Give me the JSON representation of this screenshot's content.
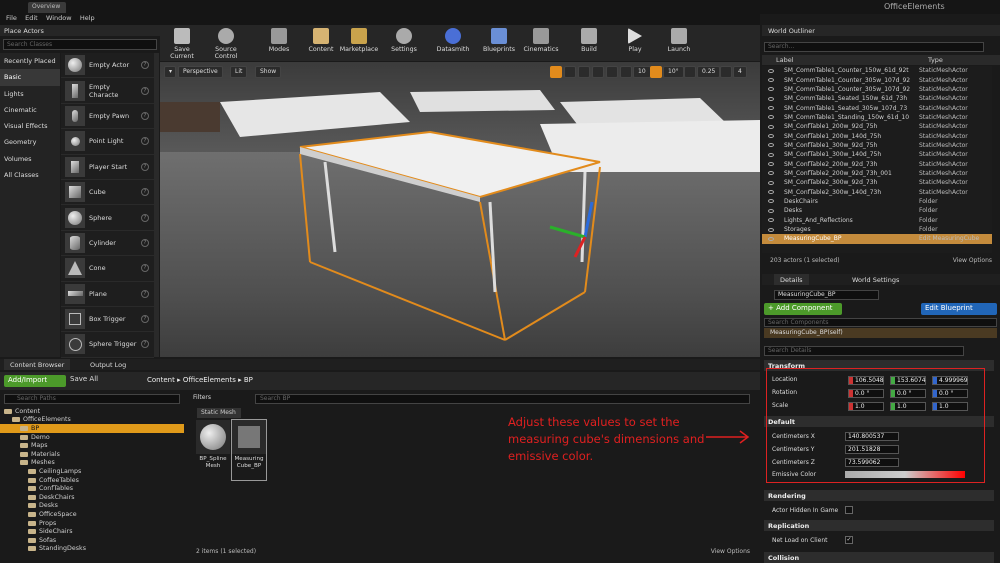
{
  "titlebar": {
    "tab": "Overview",
    "project": "OfficeElements"
  },
  "menu": [
    "File",
    "Edit",
    "Window",
    "Help"
  ],
  "place_actors": {
    "tab": "Place Actors",
    "search_placeholder": "Search Classes",
    "categories": [
      "Recently Placed",
      "Basic",
      "Lights",
      "Cinematic",
      "Visual Effects",
      "Geometry",
      "Volumes",
      "All Classes"
    ],
    "items": [
      "Empty Actor",
      "Empty Characte",
      "Empty Pawn",
      "Point Light",
      "Player Start",
      "Cube",
      "Sphere",
      "Cylinder",
      "Cone",
      "Plane",
      "Box Trigger",
      "Sphere Trigger"
    ]
  },
  "toolbar": [
    "Save Current",
    "Source Control",
    "Modes",
    "Content",
    "Marketplace",
    "Settings",
    "Datasmith",
    "Blueprints",
    "Cinematics",
    "Build",
    "Play",
    "Launch"
  ],
  "viewport": {
    "perspective": "Perspective",
    "lit": "Lit",
    "show": "Show",
    "grid_snap": "10",
    "angle_snap": "10°",
    "scale_snap": "0.25",
    "cam_speed": "4"
  },
  "outliner": {
    "tab": "World Outliner",
    "search_placeholder": "Search...",
    "col_label": "Label",
    "col_type": "Type",
    "rows": [
      [
        "SM_CommTable1_Counter_150w_61d_92t",
        "StaticMeshActor"
      ],
      [
        "SM_CommTable1_Counter_305w_107d_92",
        "StaticMeshActor"
      ],
      [
        "SM_CommTable1_Counter_305w_107d_92",
        "StaticMeshActor"
      ],
      [
        "SM_CommTable1_Seated_150w_61d_73h",
        "StaticMeshActor"
      ],
      [
        "SM_CommTable1_Seated_305w_107d_73",
        "StaticMeshActor"
      ],
      [
        "SM_CommTable1_Standing_150w_61d_10",
        "StaticMeshActor"
      ],
      [
        "SM_ConfTable1_200w_92d_75h",
        "StaticMeshActor"
      ],
      [
        "SM_ConfTable1_200w_140d_75h",
        "StaticMeshActor"
      ],
      [
        "SM_ConfTable1_300w_92d_75h",
        "StaticMeshActor"
      ],
      [
        "SM_ConfTable1_300w_140d_75h",
        "StaticMeshActor"
      ],
      [
        "SM_ConfTable2_200w_92d_73h",
        "StaticMeshActor"
      ],
      [
        "SM_ConfTable2_200w_92d_73h_001",
        "StaticMeshActor"
      ],
      [
        "SM_ConfTable2_300w_92d_73h",
        "StaticMeshActor"
      ],
      [
        "SM_ConfTable2_300w_140d_73h",
        "StaticMeshActor"
      ],
      [
        "DeskChairs",
        "Folder"
      ],
      [
        "Desks",
        "Folder"
      ],
      [
        "Lights_And_Reflections",
        "Folder"
      ],
      [
        "Storages",
        "Folder"
      ],
      [
        "MeasuringCube_BP",
        "Edit MeasuringCube"
      ]
    ],
    "status": "203 actors (1 selected)",
    "view_options": "View Options"
  },
  "details": {
    "tab": "Details",
    "tab2": "World Settings",
    "name": "MeasuringCube_BP",
    "add_component": "+ Add Component",
    "edit_blueprint": "Edit Blueprint",
    "comp_search": "Search Components",
    "self_row": "MeasuringCube_BP(self)",
    "search": "Search Details",
    "transform": {
      "title": "Transform",
      "location_label": "Location",
      "rotation_label": "Rotation",
      "scale_label": "Scale",
      "location": [
        "106.5048",
        "153.6074",
        "4.999969"
      ],
      "rotation": [
        "0.0 °",
        "0.0 °",
        "0.0 °"
      ],
      "scale": [
        "1.0",
        "1.0",
        "1.0"
      ]
    },
    "default": {
      "title": "Default",
      "cx_label": "Centimeters X",
      "cy_label": "Centimeters Y",
      "cz_label": "Centimeters Z",
      "cx": "140.800537",
      "cy": "201.51828",
      "cz": "73.599062",
      "emissive_label": "Emissive Color"
    },
    "rendering": {
      "title": "Rendering",
      "hidden_label": "Actor Hidden In Game"
    },
    "replication": {
      "title": "Replication",
      "net_label": "Net Load on Client"
    },
    "collision_title": "Collision"
  },
  "annotation": "Adjust these values to set the measuring cube's dimensions and emissive color.",
  "content_browser": {
    "tab": "Content Browser",
    "tab2": "Output Log",
    "add_import": "Add/Import",
    "save_all": "Save All",
    "crumbs": [
      "Content",
      "OfficeElements",
      "BP"
    ],
    "path_search": "Search Paths",
    "filters": "Filters",
    "asset_search": "Search BP",
    "static_label": "Static Mesh",
    "tree": [
      [
        "Content",
        0
      ],
      [
        "OfficeElements",
        1
      ],
      [
        "BP",
        2
      ],
      [
        "Demo",
        2
      ],
      [
        "Maps",
        2
      ],
      [
        "Materials",
        2
      ],
      [
        "Meshes",
        2
      ],
      [
        "CeilingLamps",
        3
      ],
      [
        "CoffeeTables",
        3
      ],
      [
        "ConfTables",
        3
      ],
      [
        "DeskChairs",
        3
      ],
      [
        "Desks",
        3
      ],
      [
        "OfficeSpace",
        3
      ],
      [
        "Props",
        3
      ],
      [
        "SideChairs",
        3
      ],
      [
        "Sofas",
        3
      ],
      [
        "StandingDesks",
        3
      ]
    ],
    "assets": [
      "BP_Spline Mesh",
      "Measuring Cube_BP"
    ],
    "status": "2 items (1 selected)",
    "view_options": "View Options"
  },
  "colors": {
    "accent_orange": "#e28b1c",
    "green": "#4c9a2a",
    "blue": "#2166b8",
    "red_annotation": "#e02020"
  }
}
